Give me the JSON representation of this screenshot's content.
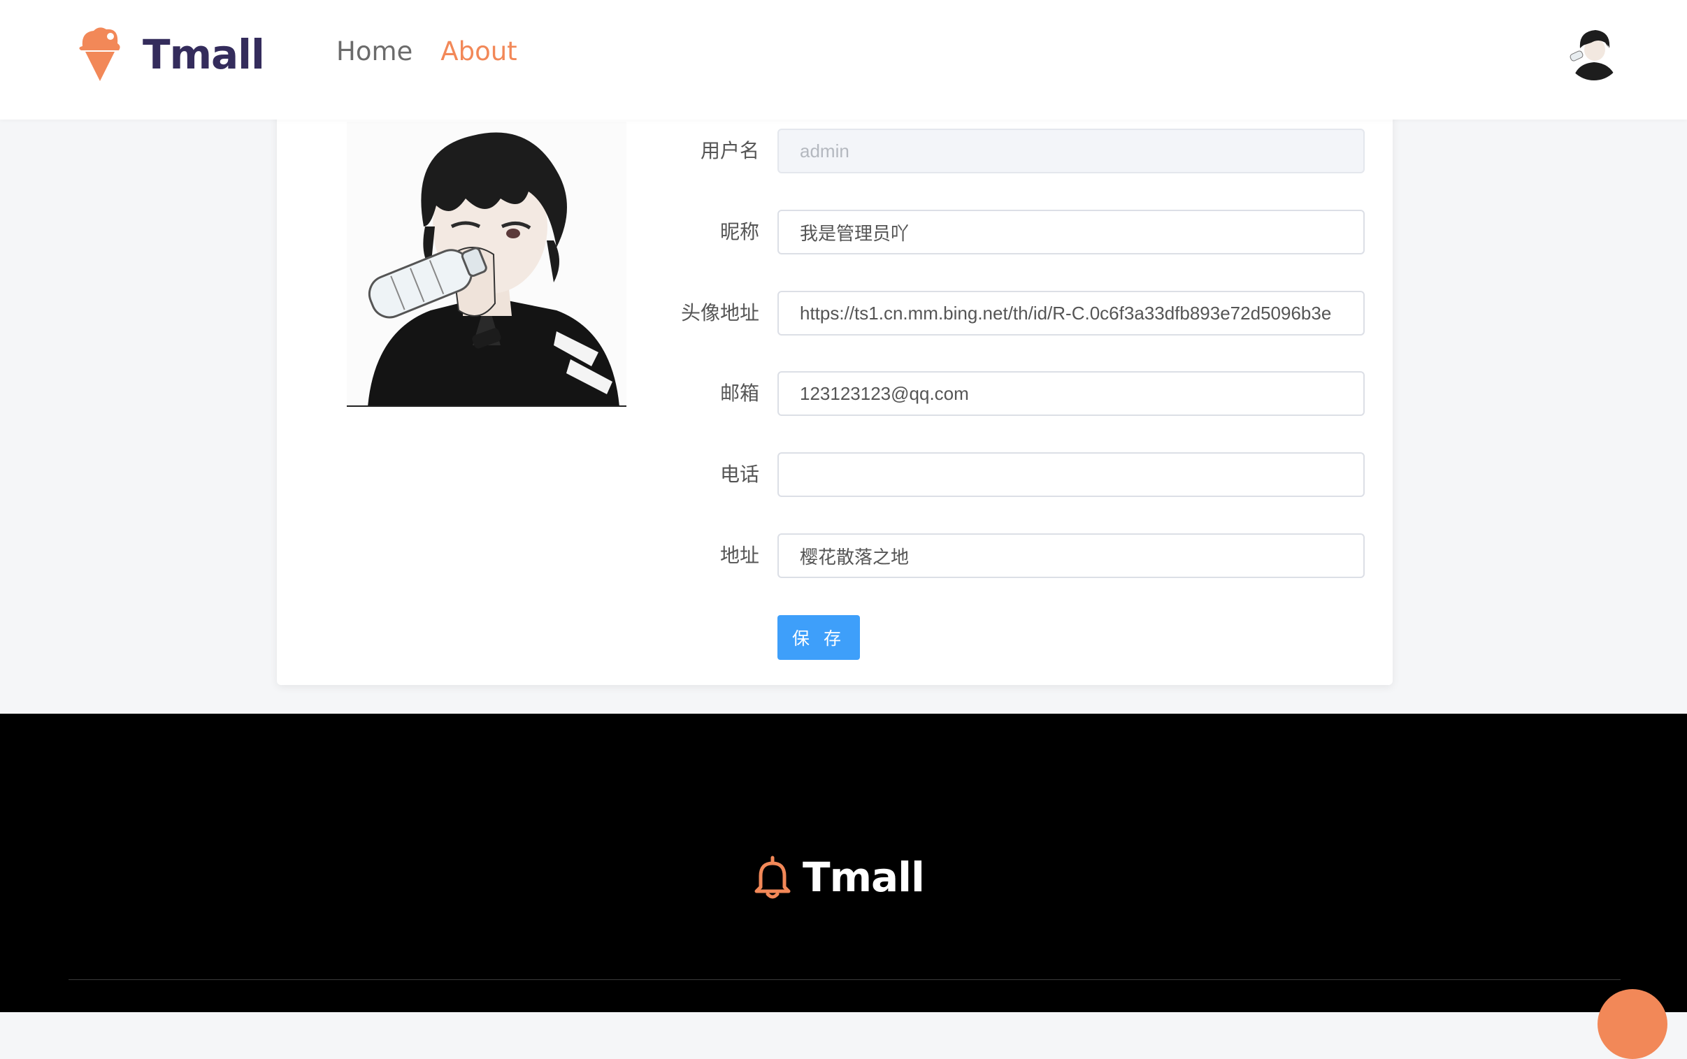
{
  "header": {
    "brand": "Tmall",
    "nav": [
      {
        "label": "Home",
        "active": false
      },
      {
        "label": "About",
        "active": true
      }
    ]
  },
  "profile_form": {
    "username": {
      "label": "用户名",
      "value": "admin"
    },
    "nickname": {
      "label": "昵称",
      "value": "我是管理员吖"
    },
    "avatar_url": {
      "label": "头像地址",
      "value": "https://ts1.cn.mm.bing.net/th/id/R-C.0c6f3a33dfb893e72d5096b3e"
    },
    "email": {
      "label": "邮箱",
      "value": "123123123@qq.com"
    },
    "phone": {
      "label": "电话",
      "value": ""
    },
    "address": {
      "label": "地址",
      "value": "樱花散落之地"
    },
    "save_label": "保 存"
  },
  "footer": {
    "brand": "Tmall"
  },
  "colors": {
    "accent": "#f28858",
    "brand_text": "#342c5c",
    "primary_button": "#3e9ffa"
  }
}
